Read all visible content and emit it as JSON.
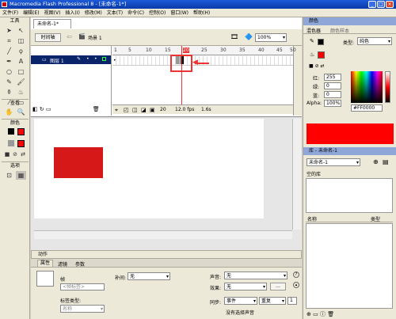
{
  "window": {
    "title": "Macromedia Flash Professional 8 - [未命名-1*]",
    "minimize": "_",
    "maximize": "□",
    "close": "×"
  },
  "menu": [
    "文件(F)",
    "编辑(E)",
    "视图(V)",
    "插入(I)",
    "修改(M)",
    "文本(T)",
    "命令(C)",
    "控制(O)",
    "窗口(W)",
    "帮助(H)"
  ],
  "tools": {
    "title": "工具",
    "view_title": "查看",
    "colors_title": "颜色",
    "options_title": "选项"
  },
  "document": {
    "tab": "未命名-1*",
    "timeline_btn": "时间轴",
    "scene": "场景 1",
    "zoom": "100%"
  },
  "timeline": {
    "layer_name": "图层 1",
    "ruler": [
      "1",
      "5",
      "10",
      "15",
      "20",
      "25",
      "30",
      "35",
      "40",
      "45",
      "50"
    ],
    "frame": "20",
    "fps": "12.0 fps",
    "time": "1.6s",
    "current_frame": 20
  },
  "stage": {
    "rect_color": "#e21b1b"
  },
  "panels": {
    "actions": "动作",
    "tabs": [
      "属性",
      "滤镜",
      "参数"
    ],
    "frame_label": "帧",
    "frame_name_placeholder": "<帧标签>",
    "label_type": "标签类型:",
    "label_type_value": "名称",
    "tween_label": "补间:",
    "tween_value": "无",
    "sound_label": "声音:",
    "sound_value": "无",
    "effect_label": "效果:",
    "effect_value": "无",
    "sync_label": "同步:",
    "sync_value": "事件",
    "repeat_value": "重复",
    "repeat_count": "1",
    "no_sound": "没有选择声音"
  },
  "color_panel": {
    "title": "颜色",
    "tabs": [
      "混色器",
      "颜色样本"
    ],
    "type_label": "类型:",
    "type_value": "纯色",
    "red_label": "红:",
    "red": "255",
    "green_label": "绿:",
    "green": "0",
    "blue_label": "蓝:",
    "blue": "0",
    "alpha_label": "Alpha:",
    "alpha": "100%",
    "hex": "#FF0000",
    "swatch": "#ff0000"
  },
  "library": {
    "title": "库 - 未命名-1",
    "doc_select": "未命名-1",
    "empty_text": "空的库",
    "col_name": "名称",
    "col_type": "类型"
  }
}
